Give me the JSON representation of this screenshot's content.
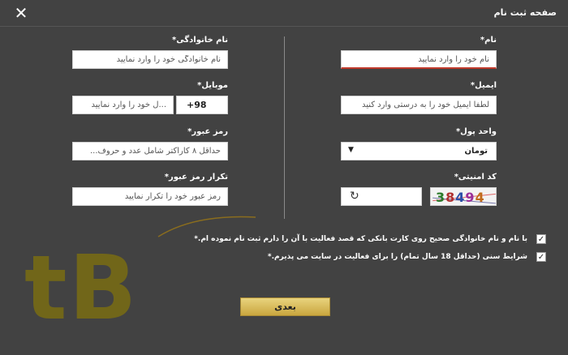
{
  "header": {
    "title": "صفحه ثبت نام",
    "close_icon": "close-icon"
  },
  "form": {
    "first_name": {
      "label": "نام*",
      "placeholder": "نام خود را وارد نمایید"
    },
    "last_name": {
      "label": "نام خانوادگی*",
      "placeholder": "نام خانوادگی خود را وارد نمایید"
    },
    "email": {
      "label": "ایمیل*",
      "placeholder": "لطفا ایمیل خود را به درستی وارد کنید"
    },
    "mobile": {
      "label": "موبایل*",
      "prefix": "+98",
      "placeholder": "...ل خود را وارد نمایید"
    },
    "currency": {
      "label": "واحد پول*",
      "selected": "تومان"
    },
    "password": {
      "label": "رمز عبور*",
      "placeholder": "حداقل ۸ کاراکتر شامل عدد و حروف..."
    },
    "security_code": {
      "label": "کد امنیتی*",
      "captcha_text": "38494"
    },
    "confirm_password": {
      "label": "تکرار رمز عبور*",
      "placeholder": "رمز عبور خود را تکرار نمایید"
    }
  },
  "checks": [
    {
      "text": "با نام و نام خانوادگی صحیح روی کارت بانکی که قصد فعالیت با آن را دارم ثبت نام نموده ام.*",
      "checked": true
    },
    {
      "text": "شرایط سنی (حداقل 18 سال تمام) را برای فعالیت در سایت می پذیرم.*",
      "checked": true
    }
  ],
  "next_label": "بعدی",
  "watermark": "tB",
  "colors": {
    "accent": "#d4b75a",
    "background": "#424242"
  }
}
